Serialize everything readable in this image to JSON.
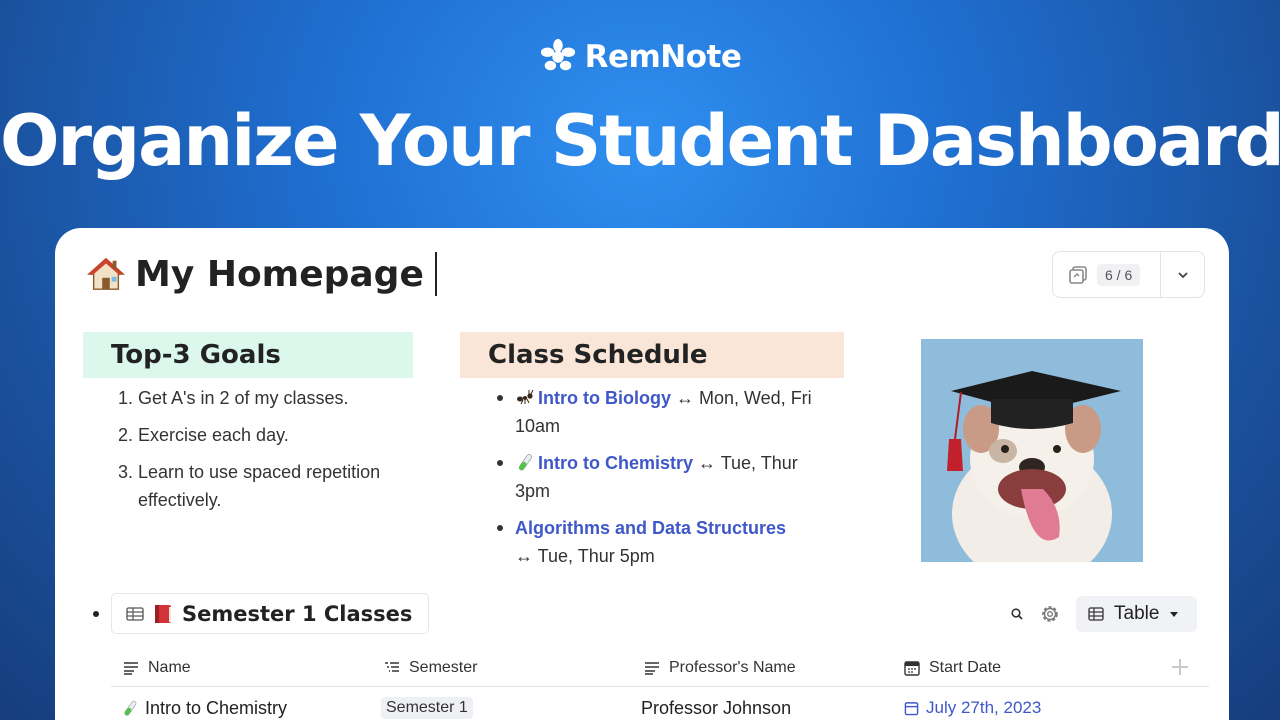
{
  "brand": {
    "name": "RemNote"
  },
  "headline": "Organize Your Student Dashboard",
  "page": {
    "title": "My Homepage"
  },
  "counter": {
    "text": "6 / 6"
  },
  "goals": {
    "title": "Top-3 Goals",
    "items": [
      {
        "num": "1.",
        "text": "Get A's in 2 of my classes."
      },
      {
        "num": "2.",
        "text": "Exercise each day."
      },
      {
        "num": "3.",
        "text": "Learn to use spaced repetition effectively."
      }
    ]
  },
  "schedule": {
    "title": "Class Schedule",
    "items": [
      {
        "icon": "ant-icon",
        "link": "Intro to Biology",
        "rest": " ↔  Mon, Wed, Fri 10am"
      },
      {
        "icon": "test-tube-icon",
        "link": "Intro to Chemistry",
        "rest": " ↔  Tue, Thur 3pm"
      },
      {
        "icon": "",
        "link": "Algorithms and Data Structures",
        "rest": " ↔  Tue, Thur 5pm"
      }
    ]
  },
  "database": {
    "title": "Semester 1 Classes",
    "view": "Table",
    "columns": [
      {
        "label": "Name",
        "icon": "text-lines-icon"
      },
      {
        "label": "Semester",
        "icon": "list-icon"
      },
      {
        "label": "Professor's Name",
        "icon": "text-lines-icon"
      },
      {
        "label": "Start Date",
        "icon": "calendar-icon"
      }
    ],
    "rows": [
      {
        "name": "Intro to Chemistry",
        "semester": "Semester 1",
        "professor": "Professor Johnson",
        "start_date": "July 27th, 2023"
      }
    ]
  },
  "colors": {
    "link": "#3f58c9",
    "goals_bg": "#dcf8ec",
    "schedule_bg": "#fae6d8",
    "background": "#1f6fd1"
  }
}
